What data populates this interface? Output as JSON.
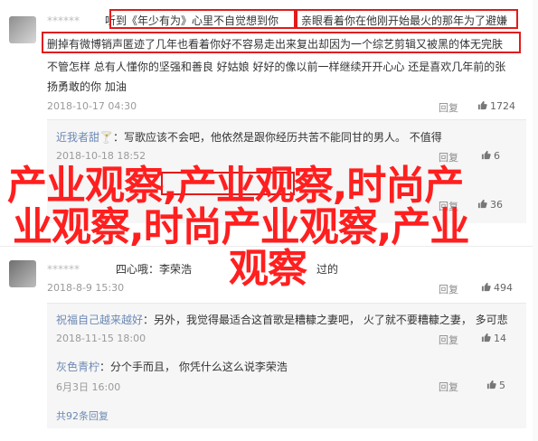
{
  "comment1": {
    "username": "******",
    "line1": "听到《年少有为》心里不自觉想到你 ",
    "line1b": "亲眼看着你在他刚开始最火的那年为了避嫌",
    "line2": "删掉有微博销声匿迹了几年也看着你好不容易走出来复出却因为一个综艺剪辑又被黑的体无完肤",
    "line3": "不管怎样 总有人懂你的坚强和善良 好姑娘 好好的像以前一样继续开开心心 还是喜欢几年前的张",
    "line4": "扬勇敢的你 加油",
    "date": "2018-10-17 04:30",
    "reply": "回复",
    "likes": "1724"
  },
  "sub1a": {
    "username": "近我者甜",
    "text": "：写歌应该不会吧，他依然是跟你经历共苦不能同甘的男人。 ",
    "extra": "不值得",
    "date": "2018-10-18 18:52",
    "reply": "回复",
    "likes": "6"
  },
  "sub1b": {
    "reply": "回复",
    "likes": "36"
  },
  "overlay": {
    "line1": "产业观察,产业观察,时尚产",
    "line2": "业观察,时尚产业观察,产业",
    "line3": "观察"
  },
  "comment2": {
    "username": "******",
    "text": "四心哦：李荣浩 ",
    "text2": "过的",
    "date": "2018-8-9 15:30",
    "reply": "回复",
    "likes": "494"
  },
  "sub2a": {
    "username": "祝福自己越来越好",
    "text": "：另外，我觉得最适合这首歌是糟糠之妻吧， 火了就不要糟糠之妻， 多可悲",
    "date": "2018-11-15 18:00",
    "reply": "回复",
    "likes": "14"
  },
  "sub2b": {
    "username": "灰色青柠",
    "text": "：分个手而且， 你凭什么这么说李荣浩",
    "date": "6月3日 16:00",
    "reply": "回复",
    "likes": "5"
  },
  "more": "共92条回复"
}
